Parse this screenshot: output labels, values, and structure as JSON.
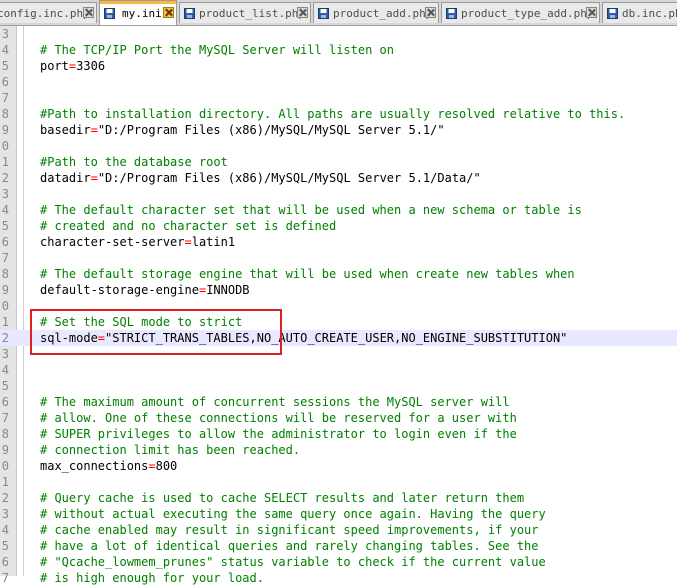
{
  "tabs": [
    {
      "label": "config.inc.php",
      "active": false
    },
    {
      "label": "my.ini",
      "active": true
    },
    {
      "label": "product_list.php",
      "active": false
    },
    {
      "label": "product_add.php",
      "active": false
    },
    {
      "label": "product_type_add.php",
      "active": false
    },
    {
      "label": "db.inc.php",
      "active": false
    }
  ],
  "lines": [
    {
      "num": "3",
      "comment": "",
      "key": "",
      "op": "",
      "value": ""
    },
    {
      "num": "4",
      "comment": "# The TCP/IP Port the MySQL Server will listen on",
      "key": "",
      "op": "",
      "value": ""
    },
    {
      "num": "5",
      "comment": "",
      "key": "port",
      "op": "=",
      "value": "3306"
    },
    {
      "num": "6",
      "comment": "",
      "key": "",
      "op": "",
      "value": ""
    },
    {
      "num": "7",
      "comment": "",
      "key": "",
      "op": "",
      "value": ""
    },
    {
      "num": "8",
      "comment": "#Path to installation directory. All paths are usually resolved relative to this.",
      "key": "",
      "op": "",
      "value": ""
    },
    {
      "num": "9",
      "comment": "",
      "key": "basedir",
      "op": "=",
      "value": "\"D:/Program Files (x86)/MySQL/MySQL Server 5.1/\""
    },
    {
      "num": "0",
      "comment": "",
      "key": "",
      "op": "",
      "value": ""
    },
    {
      "num": "1",
      "comment": "#Path to the database root",
      "key": "",
      "op": "",
      "value": ""
    },
    {
      "num": "2",
      "comment": "",
      "key": "datadir",
      "op": "=",
      "value": "\"D:/Program Files (x86)/MySQL/MySQL Server 5.1/Data/\""
    },
    {
      "num": "3",
      "comment": "",
      "key": "",
      "op": "",
      "value": ""
    },
    {
      "num": "4",
      "comment": "# The default character set that will be used when a new schema or table is",
      "key": "",
      "op": "",
      "value": ""
    },
    {
      "num": "5",
      "comment": "# created and no character set is defined",
      "key": "",
      "op": "",
      "value": ""
    },
    {
      "num": "6",
      "comment": "",
      "key": "character-set-server",
      "op": "=",
      "value": "latin1"
    },
    {
      "num": "7",
      "comment": "",
      "key": "",
      "op": "",
      "value": ""
    },
    {
      "num": "8",
      "comment": "# The default storage engine that will be used when create new tables when",
      "key": "",
      "op": "",
      "value": ""
    },
    {
      "num": "9",
      "comment": "",
      "key": "default-storage-engine",
      "op": "=",
      "value": "INNODB"
    },
    {
      "num": "0",
      "comment": "",
      "key": "",
      "op": "",
      "value": ""
    },
    {
      "num": "1",
      "comment": "# Set the SQL mode to strict",
      "key": "",
      "op": "",
      "value": ""
    },
    {
      "num": "2",
      "comment": "",
      "key": "sql-mode",
      "op": "=",
      "value": "\"STRICT_TRANS_TABLES,NO_AUTO_CREATE_USER,NO_ENGINE_SUBSTITUTION\"",
      "current": true
    },
    {
      "num": "3",
      "comment": "",
      "key": "",
      "op": "",
      "value": ""
    },
    {
      "num": "4",
      "comment": "",
      "key": "",
      "op": "",
      "value": ""
    },
    {
      "num": "5",
      "comment": "",
      "key": "",
      "op": "",
      "value": ""
    },
    {
      "num": "6",
      "comment": "# The maximum amount of concurrent sessions the MySQL server will",
      "key": "",
      "op": "",
      "value": ""
    },
    {
      "num": "7",
      "comment": "# allow. One of these connections will be reserved for a user with",
      "key": "",
      "op": "",
      "value": ""
    },
    {
      "num": "8",
      "comment": "# SUPER privileges to allow the administrator to login even if the",
      "key": "",
      "op": "",
      "value": ""
    },
    {
      "num": "9",
      "comment": "# connection limit has been reached.",
      "key": "",
      "op": "",
      "value": ""
    },
    {
      "num": "0",
      "comment": "",
      "key": "max_connections",
      "op": "=",
      "value": "800"
    },
    {
      "num": "1",
      "comment": "",
      "key": "",
      "op": "",
      "value": ""
    },
    {
      "num": "2",
      "comment": "# Query cache is used to cache SELECT results and later return them",
      "key": "",
      "op": "",
      "value": ""
    },
    {
      "num": "3",
      "comment": "# without actual executing the same query once again. Having the query",
      "key": "",
      "op": "",
      "value": ""
    },
    {
      "num": "4",
      "comment": "# cache enabled may result in significant speed improvements, if your",
      "key": "",
      "op": "",
      "value": ""
    },
    {
      "num": "5",
      "comment": "# have a lot of identical queries and rarely changing tables. See the",
      "key": "",
      "op": "",
      "value": ""
    },
    {
      "num": "6",
      "comment": "# \"Qcache_lowmem_prunes\" status variable to check if the current value",
      "key": "",
      "op": "",
      "value": ""
    },
    {
      "num": "7",
      "comment": "# is high enough for your load.",
      "key": "",
      "op": "",
      "value": ""
    }
  ],
  "colors": {
    "comment": "#008000",
    "operator": "#ff0000",
    "highlight_box": "#e02020",
    "active_tab_accent": "#fab83e"
  }
}
